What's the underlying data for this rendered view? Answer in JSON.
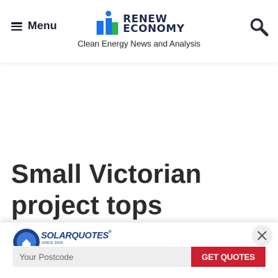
{
  "header": {
    "menu_label": "Menu",
    "logo_line1": "RENEW",
    "logo_line2": "ECONOMY",
    "tagline": "Clean Energy News and Analysis",
    "icons": {
      "menu": "hamburger-icon",
      "search": "search-icon"
    }
  },
  "article": {
    "headline": "Small Victorian project tops"
  },
  "ad": {
    "brand": "SOLARQUOTES",
    "since": "SINCE 2009",
    "postcode_placeholder": "Your Postcode",
    "postcode_value": "",
    "cta_label": "GET QUOTES",
    "icons": {
      "close": "close-icon",
      "logo": "house-sun-icon"
    }
  },
  "colors": {
    "logo_blue": "#1a73e8",
    "logo_green": "#2db34a",
    "logo_text": "#1d2a4a",
    "cta_red": "#cc1f2f",
    "solarquotes_blue": "#1d3f8f",
    "input_bg": "#eeeeee"
  }
}
